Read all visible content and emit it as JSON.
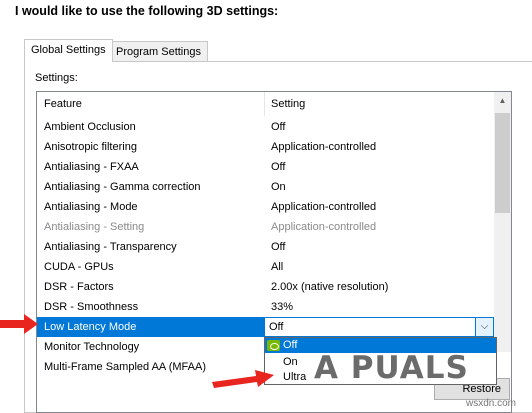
{
  "heading": "I would like to use the following 3D settings:",
  "tabs": [
    {
      "label": "Global Settings",
      "active": true
    },
    {
      "label": "Program Settings",
      "active": false
    }
  ],
  "settings_label": "Settings:",
  "table": {
    "headers": [
      "Feature",
      "Setting"
    ],
    "rows": [
      {
        "feature": "Ambient Occlusion",
        "setting": "Off",
        "state": "normal"
      },
      {
        "feature": "Anisotropic filtering",
        "setting": "Application-controlled",
        "state": "normal"
      },
      {
        "feature": "Antialiasing - FXAA",
        "setting": "Off",
        "state": "normal"
      },
      {
        "feature": "Antialiasing - Gamma correction",
        "setting": "On",
        "state": "normal"
      },
      {
        "feature": "Antialiasing - Mode",
        "setting": "Application-controlled",
        "state": "normal"
      },
      {
        "feature": "Antialiasing - Setting",
        "setting": "Application-controlled",
        "state": "disabled"
      },
      {
        "feature": "Antialiasing - Transparency",
        "setting": "Off",
        "state": "normal"
      },
      {
        "feature": "CUDA - GPUs",
        "setting": "All",
        "state": "normal"
      },
      {
        "feature": "DSR - Factors",
        "setting": "2.00x (native resolution)",
        "state": "normal"
      },
      {
        "feature": "DSR - Smoothness",
        "setting": "33%",
        "state": "normal"
      },
      {
        "feature": "Low Latency Mode",
        "setting": "Off",
        "state": "selected"
      },
      {
        "feature": "Monitor Technology",
        "setting": "",
        "state": "normal"
      },
      {
        "feature": "Multi-Frame Sampled AA (MFAA)",
        "setting": "",
        "state": "normal"
      }
    ]
  },
  "dropdown": {
    "current_value": "Off",
    "options": [
      {
        "label": "Off",
        "selected": true
      },
      {
        "label": "On",
        "selected": false
      },
      {
        "label": "Ultra",
        "selected": false
      }
    ]
  },
  "restore_button": "Restore",
  "watermark": {
    "logo_text": "A PUALS",
    "site": "wsxdn.com"
  },
  "colors": {
    "selection": "#0078d7",
    "nvidia_green": "#76b900",
    "arrow_red": "#e8251f"
  }
}
